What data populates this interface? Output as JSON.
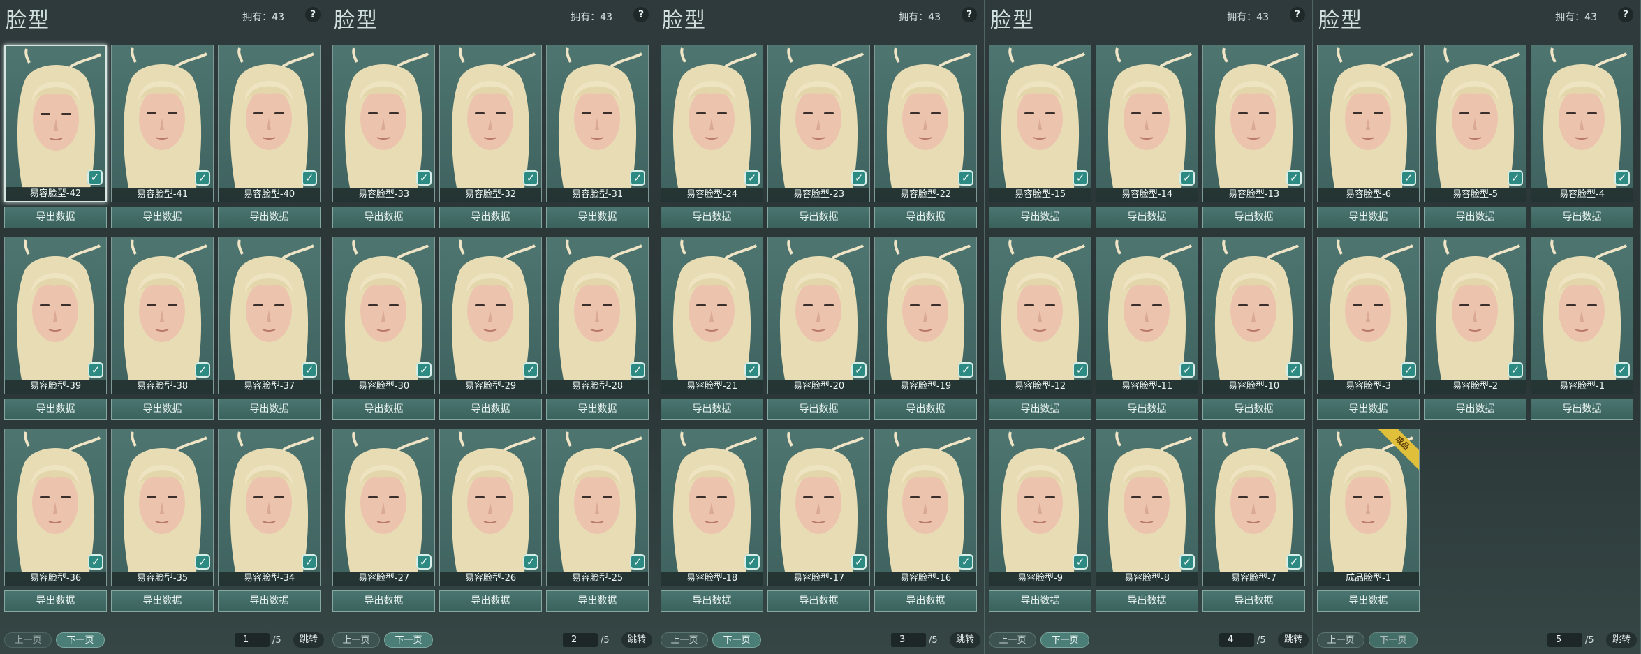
{
  "colors": {
    "accent": "#4a7e76",
    "card_bg": "#4e7570",
    "check": "#2c8a82",
    "ribbon": "#e0c03a"
  },
  "panels": [
    {
      "title": "脸型",
      "owned": "拥有：43",
      "help": "?",
      "cards": [
        {
          "label": "易容脸型-42",
          "owned": true
        },
        {
          "label": "易容脸型-41",
          "owned": true
        },
        {
          "label": "易容脸型-40",
          "owned": true
        },
        {
          "label": "易容脸型-39",
          "owned": true
        },
        {
          "label": "易容脸型-38",
          "owned": true
        },
        {
          "label": "易容脸型-37",
          "owned": true
        },
        {
          "label": "易容脸型-36",
          "owned": true
        },
        {
          "label": "易容脸型-35",
          "owned": true
        },
        {
          "label": "易容脸型-34",
          "owned": true
        }
      ],
      "export_label": "导出数据",
      "prev": "上一页",
      "next": "下一页",
      "page": "1",
      "total": "/5",
      "jump": "跳转"
    },
    {
      "title": "脸型",
      "owned": "拥有：43",
      "help": "?",
      "cards": [
        {
          "label": "易容脸型-33",
          "owned": true
        },
        {
          "label": "易容脸型-32",
          "owned": true
        },
        {
          "label": "易容脸型-31",
          "owned": true
        },
        {
          "label": "易容脸型-30",
          "owned": true
        },
        {
          "label": "易容脸型-29",
          "owned": true
        },
        {
          "label": "易容脸型-28",
          "owned": true
        },
        {
          "label": "易容脸型-27",
          "owned": true
        },
        {
          "label": "易容脸型-26",
          "owned": true
        },
        {
          "label": "易容脸型-25",
          "owned": true
        }
      ],
      "export_label": "导出数据",
      "prev": "上一页",
      "next": "下一页",
      "page": "2",
      "total": "/5",
      "jump": "跳转"
    },
    {
      "title": "脸型",
      "owned": "拥有：43",
      "help": "?",
      "cards": [
        {
          "label": "易容脸型-24",
          "owned": true
        },
        {
          "label": "易容脸型-23",
          "owned": true
        },
        {
          "label": "易容脸型-22",
          "owned": true
        },
        {
          "label": "易容脸型-21",
          "owned": true
        },
        {
          "label": "易容脸型-20",
          "owned": true
        },
        {
          "label": "易容脸型-19",
          "owned": true
        },
        {
          "label": "易容脸型-18",
          "owned": true
        },
        {
          "label": "易容脸型-17",
          "owned": true
        },
        {
          "label": "易容脸型-16",
          "owned": true
        }
      ],
      "export_label": "导出数据",
      "prev": "上一页",
      "next": "下一页",
      "page": "3",
      "total": "/5",
      "jump": "跳转"
    },
    {
      "title": "脸型",
      "owned": "拥有：43",
      "help": "?",
      "cards": [
        {
          "label": "易容脸型-15",
          "owned": true
        },
        {
          "label": "易容脸型-14",
          "owned": true
        },
        {
          "label": "易容脸型-13",
          "owned": true
        },
        {
          "label": "易容脸型-12",
          "owned": true
        },
        {
          "label": "易容脸型-11",
          "owned": true
        },
        {
          "label": "易容脸型-10",
          "owned": true
        },
        {
          "label": "易容脸型-9",
          "owned": true
        },
        {
          "label": "易容脸型-8",
          "owned": true
        },
        {
          "label": "易容脸型-7",
          "owned": true
        }
      ],
      "export_label": "导出数据",
      "prev": "上一页",
      "next": "下一页",
      "page": "4",
      "total": "/5",
      "jump": "跳转"
    },
    {
      "title": "脸型",
      "owned": "拥有：43",
      "help": "?",
      "cards": [
        {
          "label": "易容脸型-6",
          "owned": true
        },
        {
          "label": "易容脸型-5",
          "owned": true
        },
        {
          "label": "易容脸型-4",
          "owned": true
        },
        {
          "label": "易容脸型-3",
          "owned": true
        },
        {
          "label": "易容脸型-2",
          "owned": true
        },
        {
          "label": "易容脸型-1",
          "owned": true
        },
        {
          "label": "成品脸型-1",
          "owned": false,
          "ribbon": "成品"
        }
      ],
      "export_label": "导出数据",
      "prev": "上一页",
      "next": "下一页",
      "page": "5",
      "total": "/5",
      "jump": "跳转"
    }
  ]
}
